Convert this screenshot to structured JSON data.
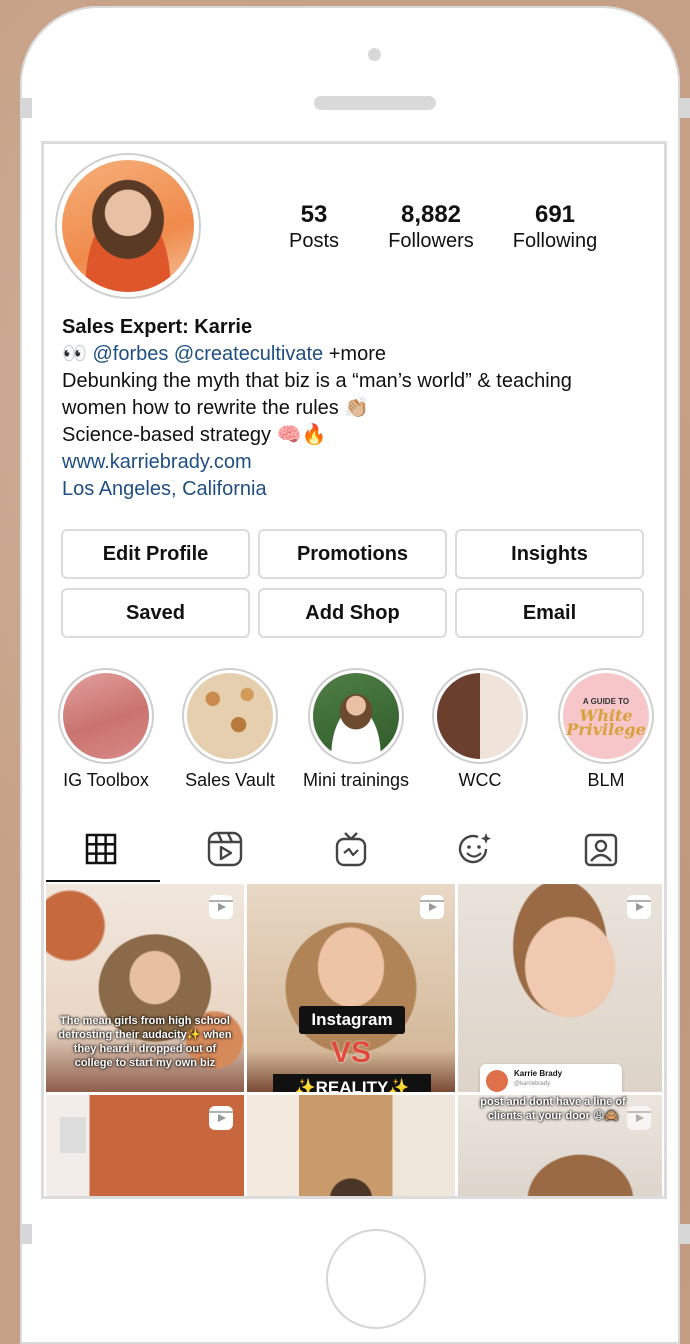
{
  "profile": {
    "stats": [
      {
        "value": "53",
        "label": "Posts"
      },
      {
        "value": "8,882",
        "label": "Followers"
      },
      {
        "value": "691",
        "label": "Following"
      }
    ],
    "name": "Sales Expert: Karrie",
    "bio_line1_emoji": "👀",
    "bio_mention1": "@forbes",
    "bio_mention2": "@createcultivate",
    "bio_more": "+more",
    "bio_line2": "Debunking the myth that biz is a “man’s world” & teaching",
    "bio_line3": "women how to rewrite the rules 👏🏼",
    "bio_line4": "Science-based strategy 🧠🔥",
    "website": "www.karriebrady.com",
    "location": "Los Angeles, California"
  },
  "buttons": [
    "Edit Profile",
    "Promotions",
    "Insights",
    "Saved",
    "Add Shop",
    "Email"
  ],
  "highlights": [
    {
      "label": "IG Toolbox",
      "color": "#d98a88"
    },
    {
      "label": "Sales Vault",
      "color": "#d9b48a"
    },
    {
      "label": "Mini trainings",
      "color": "#3f6b3a"
    },
    {
      "label": "WCC",
      "color": "#8a5a45"
    },
    {
      "label": "BLM",
      "color": "#f6c6c8",
      "text_line1": "A GUIDE TO",
      "text_line2": "White",
      "text_line3": "Privilege"
    }
  ],
  "tabs": [
    "grid-icon",
    "reels-icon",
    "igtv-icon",
    "effects-icon",
    "tagged-icon"
  ],
  "posts": [
    {
      "caption": "The mean girls from high school defrosting their audacity✨ when they heard i dropped out of college to start my own biz"
    },
    {
      "caption_line1": "Instagram",
      "caption_line2": "VS",
      "caption_line3": "✨REALITY✨"
    },
    {
      "card_name": "Karrie Brady",
      "card_handle": "@karriebrady",
      "caption": "post and dont have a line of clients at your door 😩🙈"
    },
    {},
    {},
    {}
  ]
}
